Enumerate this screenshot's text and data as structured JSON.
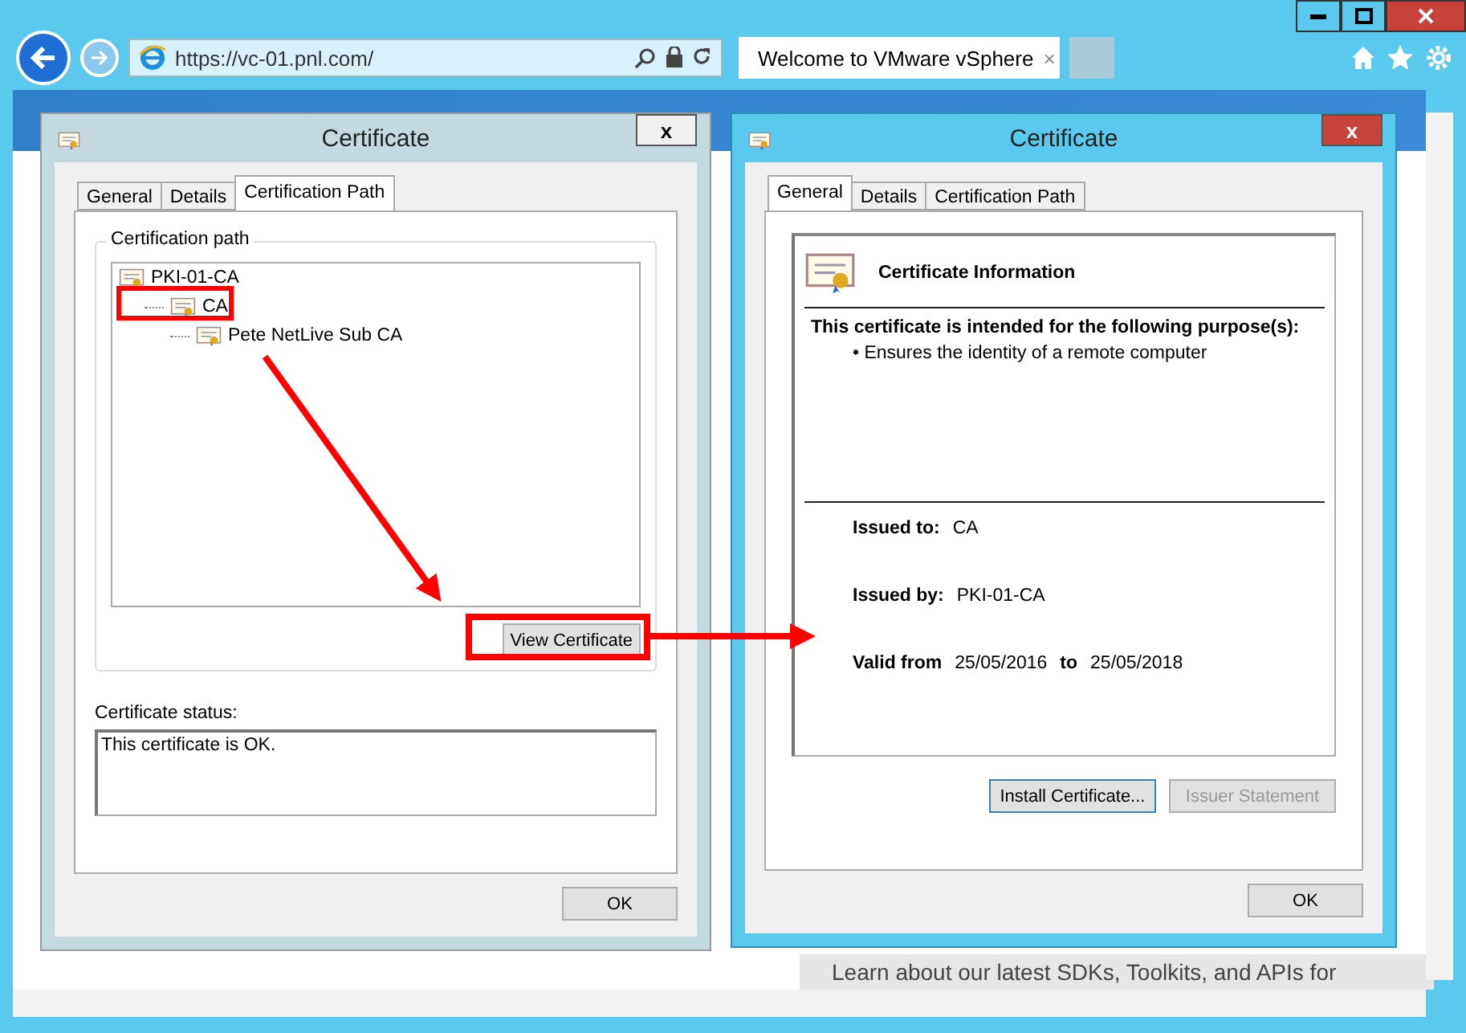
{
  "browser": {
    "address": "https://vc-01.pnl.com/",
    "tab": {
      "title": "Welcome to VMware vSphere",
      "close": "×"
    }
  },
  "page": {
    "footer_text": "Learn about our latest SDKs, Toolkits, and APIs for"
  },
  "left_dialog": {
    "title": "Certificate",
    "close": "x",
    "active": false,
    "tabs": [
      {
        "label": "General",
        "selected": false
      },
      {
        "label": "Details",
        "selected": false
      },
      {
        "label": "Certification Path",
        "selected": true
      }
    ],
    "group_label": "Certification path",
    "tree": [
      {
        "label": "PKI-01-CA",
        "children": [
          {
            "label": "CA",
            "children": [
              {
                "label": "Pete NetLive Sub CA"
              }
            ]
          }
        ]
      }
    ],
    "view_button": "View Certificate",
    "status_label": "Certificate status:",
    "status_text": "This certificate is OK.",
    "ok": "OK"
  },
  "right_dialog": {
    "title": "Certificate",
    "close": "x",
    "active": true,
    "tabs": [
      {
        "label": "General",
        "selected": true
      },
      {
        "label": "Details",
        "selected": false
      },
      {
        "label": "Certification Path",
        "selected": false
      }
    ],
    "info_title": "Certificate Information",
    "purpose_heading": "This certificate is intended for the following purpose(s):",
    "purposes": [
      "• Ensures the identity of a remote computer"
    ],
    "issued_to_label": "Issued to:",
    "issued_to": "CA",
    "issued_by_label": "Issued by:",
    "issued_by": "PKI-01-CA",
    "valid_from_label": "Valid from",
    "valid_from": "25/05/2016",
    "valid_to_label": "to",
    "valid_to": "25/05/2018",
    "buttons": [
      {
        "label": "Install Certificate...",
        "disabled": false
      },
      {
        "label": "Issuer Statement",
        "disabled": true
      }
    ],
    "ok": "OK"
  }
}
